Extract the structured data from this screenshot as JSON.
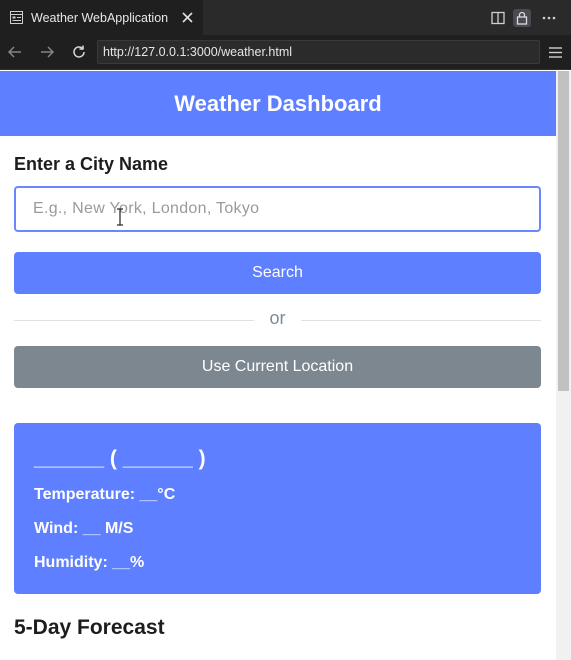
{
  "browser": {
    "tab_title": "Weather WebApplication",
    "url": "http://127.0.0.1:3000/weather.html",
    "icons": [
      "favicon-icon",
      "close-icon",
      "split-view-icon",
      "lock-icon",
      "more-icon",
      "back-icon",
      "forward-icon",
      "reload-icon",
      "menu-icon"
    ]
  },
  "header": {
    "title": "Weather Dashboard"
  },
  "search": {
    "label": "Enter a City Name",
    "placeholder": "E.g., New York, London, Tokyo",
    "value": "",
    "button_label": "Search"
  },
  "divider": {
    "text": "or"
  },
  "location": {
    "button_label": "Use Current Location"
  },
  "current_weather": {
    "heading": "______ ( ______ )",
    "temperature": "Temperature: __°C",
    "wind": "Wind: __ M/S",
    "humidity": "Humidity: __%"
  },
  "forecast": {
    "title": "5-Day Forecast"
  },
  "colors": {
    "accent": "#5e7fff",
    "secondary_button": "#7d878f",
    "browser_dark": "#1f1f1f"
  }
}
